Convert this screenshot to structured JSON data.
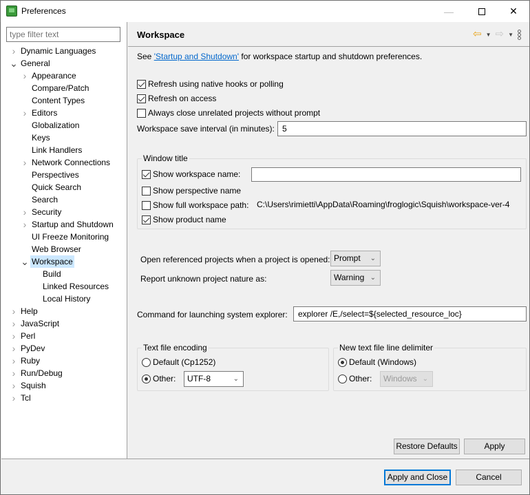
{
  "window": {
    "title": "Preferences",
    "icon": "squish-frog-icon",
    "controls": {
      "minimize": "—",
      "close": "✕"
    }
  },
  "filter": {
    "placeholder": "type filter text",
    "value": ""
  },
  "tree": [
    {
      "label": "Dynamic Languages",
      "level": 0,
      "twisty": "collapsed"
    },
    {
      "label": "General",
      "level": 0,
      "twisty": "expanded"
    },
    {
      "label": "Appearance",
      "level": 1,
      "twisty": "collapsed"
    },
    {
      "label": "Compare/Patch",
      "level": 1,
      "twisty": "none"
    },
    {
      "label": "Content Types",
      "level": 1,
      "twisty": "none"
    },
    {
      "label": "Editors",
      "level": 1,
      "twisty": "collapsed"
    },
    {
      "label": "Globalization",
      "level": 1,
      "twisty": "none"
    },
    {
      "label": "Keys",
      "level": 1,
      "twisty": "none"
    },
    {
      "label": "Link Handlers",
      "level": 1,
      "twisty": "none"
    },
    {
      "label": "Network Connections",
      "level": 1,
      "twisty": "collapsed"
    },
    {
      "label": "Perspectives",
      "level": 1,
      "twisty": "none"
    },
    {
      "label": "Quick Search",
      "level": 1,
      "twisty": "none"
    },
    {
      "label": "Search",
      "level": 1,
      "twisty": "none"
    },
    {
      "label": "Security",
      "level": 1,
      "twisty": "collapsed"
    },
    {
      "label": "Startup and Shutdown",
      "level": 1,
      "twisty": "collapsed"
    },
    {
      "label": "UI Freeze Monitoring",
      "level": 1,
      "twisty": "none"
    },
    {
      "label": "Web Browser",
      "level": 1,
      "twisty": "none"
    },
    {
      "label": "Workspace",
      "level": 1,
      "twisty": "expanded",
      "selected": true
    },
    {
      "label": "Build",
      "level": 2,
      "twisty": "none"
    },
    {
      "label": "Linked Resources",
      "level": 2,
      "twisty": "none"
    },
    {
      "label": "Local History",
      "level": 2,
      "twisty": "none"
    },
    {
      "label": "Help",
      "level": 0,
      "twisty": "collapsed"
    },
    {
      "label": "JavaScript",
      "level": 0,
      "twisty": "collapsed"
    },
    {
      "label": "Perl",
      "level": 0,
      "twisty": "collapsed"
    },
    {
      "label": "PyDev",
      "level": 0,
      "twisty": "collapsed"
    },
    {
      "label": "Ruby",
      "level": 0,
      "twisty": "collapsed"
    },
    {
      "label": "Run/Debug",
      "level": 0,
      "twisty": "collapsed"
    },
    {
      "label": "Squish",
      "level": 0,
      "twisty": "collapsed"
    },
    {
      "label": "Tcl",
      "level": 0,
      "twisty": "collapsed"
    }
  ],
  "page": {
    "title": "Workspace",
    "nav": {
      "back": "⇦",
      "forward": "⇨",
      "dropdown": "▼"
    },
    "intro": {
      "prefix": "See ",
      "link": "'Startup and Shutdown'",
      "suffix": " for workspace startup and shutdown preferences."
    },
    "options": [
      {
        "label": "Refresh using native hooks or polling",
        "checked": true
      },
      {
        "label": "Refresh on access",
        "checked": true
      },
      {
        "label": "Always close unrelated projects without prompt",
        "checked": false
      }
    ],
    "save_interval": {
      "label": "Workspace save interval (in minutes):",
      "value": "5"
    },
    "window_title": {
      "title": "Window title",
      "show_workspace_name": {
        "label": "Show workspace name:",
        "checked": true,
        "value": ""
      },
      "show_perspective_name": {
        "label": "Show perspective name",
        "checked": false
      },
      "show_full_path": {
        "label": "Show full workspace path:",
        "checked": false,
        "path": "C:\\Users\\rimietti\\AppData\\Roaming\\froglogic\\Squish\\workspace-ver-4"
      },
      "show_product_name": {
        "label": "Show product name",
        "checked": true
      }
    },
    "open_referenced": {
      "label": "Open referenced projects when a project is opened:",
      "value": "Prompt"
    },
    "report_unknown": {
      "label": "Report unknown project nature as:",
      "value": "Warning"
    },
    "explorer_cmd": {
      "label": "Command for launching system explorer:",
      "value": "explorer /E,/select=${selected_resource_loc}"
    },
    "encoding": {
      "title": "Text file encoding",
      "default_label": "Default (Cp1252)",
      "default_checked": false,
      "other_label": "Other:",
      "other_checked": true,
      "other_value": "UTF-8"
    },
    "line_delimiter": {
      "title": "New text file line delimiter",
      "default_label": "Default (Windows)",
      "default_checked": true,
      "other_label": "Other:",
      "other_checked": false,
      "other_value": "Windows"
    },
    "buttons": {
      "restore_defaults": "Restore Defaults",
      "apply": "Apply"
    }
  },
  "footer": {
    "apply_and_close": "Apply and Close",
    "cancel": "Cancel"
  },
  "chevron": "⌄",
  "twisty_collapsed": "›",
  "twisty_expanded": "⌄"
}
